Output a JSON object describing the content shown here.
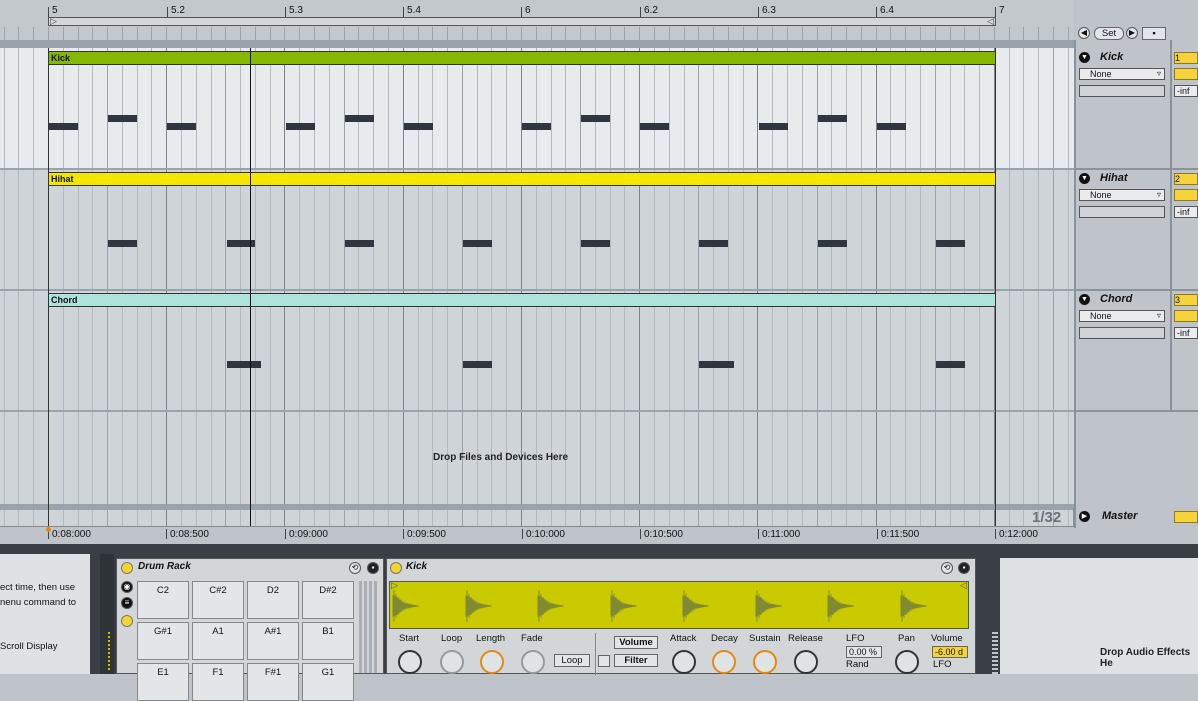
{
  "ruler": {
    "bars": [
      "5",
      "5.2",
      "5.3",
      "5.4",
      "6",
      "6.2",
      "6.3",
      "6.4",
      "7"
    ]
  },
  "set_controls": {
    "prev": "◀",
    "set_label": "Set",
    "next": "▶"
  },
  "tracks": [
    {
      "name": "Kick",
      "clip": "Kick",
      "clip_color": "#86b800",
      "bg": "#e8ebed",
      "send": "None",
      "inf": "-inf",
      "num": "1"
    },
    {
      "name": "Hihat",
      "clip": "Hihat",
      "clip_color": "#f5e600",
      "bg": "#cfd4d8",
      "send": "None",
      "inf": "-inf",
      "num": "2"
    },
    {
      "name": "Chord",
      "clip": "Chord",
      "clip_color": "#aee2da",
      "bg": "#cfd4d8",
      "send": "None",
      "inf": "-inf",
      "num": "3"
    }
  ],
  "drop_text": "Drop Files and Devices Here",
  "zoom": "1/32",
  "master": {
    "name": "Master"
  },
  "time_ruler": [
    "0:08:000",
    "0:08:500",
    "0:09:000",
    "0:09:500",
    "0:10:000",
    "0:10:500",
    "0:11:000",
    "0:11:500",
    "0:12:000"
  ],
  "info_panel": {
    "line1": "ect time, then use",
    "line2": "nenu command to",
    "line3": "Scroll Display"
  },
  "drum_rack": {
    "title": "Drum Rack",
    "pads": [
      "C2",
      "C#2",
      "D2",
      "D#2",
      "G#1",
      "A1",
      "A#1",
      "B1",
      "E1",
      "F1",
      "F#1",
      "G1"
    ]
  },
  "sampler": {
    "title": "Kick",
    "params": [
      "Start",
      "Loop",
      "Length",
      "Fade",
      "Attack",
      "Decay",
      "Sustain",
      "Release"
    ],
    "loop_btn": "Loop",
    "volume_btn": "Volume",
    "filter_btn": "Filter",
    "lfo_label": "LFO",
    "lfo_value": "0.00 %",
    "rand_label": "Rand",
    "pan_label": "Pan",
    "volume_label": "Volume",
    "volume_value": "-6.00 d",
    "lfo2_label": "LFO"
  },
  "fx_drop": "Drop Audio Effects He",
  "colors": {
    "accent_yellow": "#f7d33a",
    "wave": "#c9cb00",
    "orange_knob": "#e08a10"
  }
}
